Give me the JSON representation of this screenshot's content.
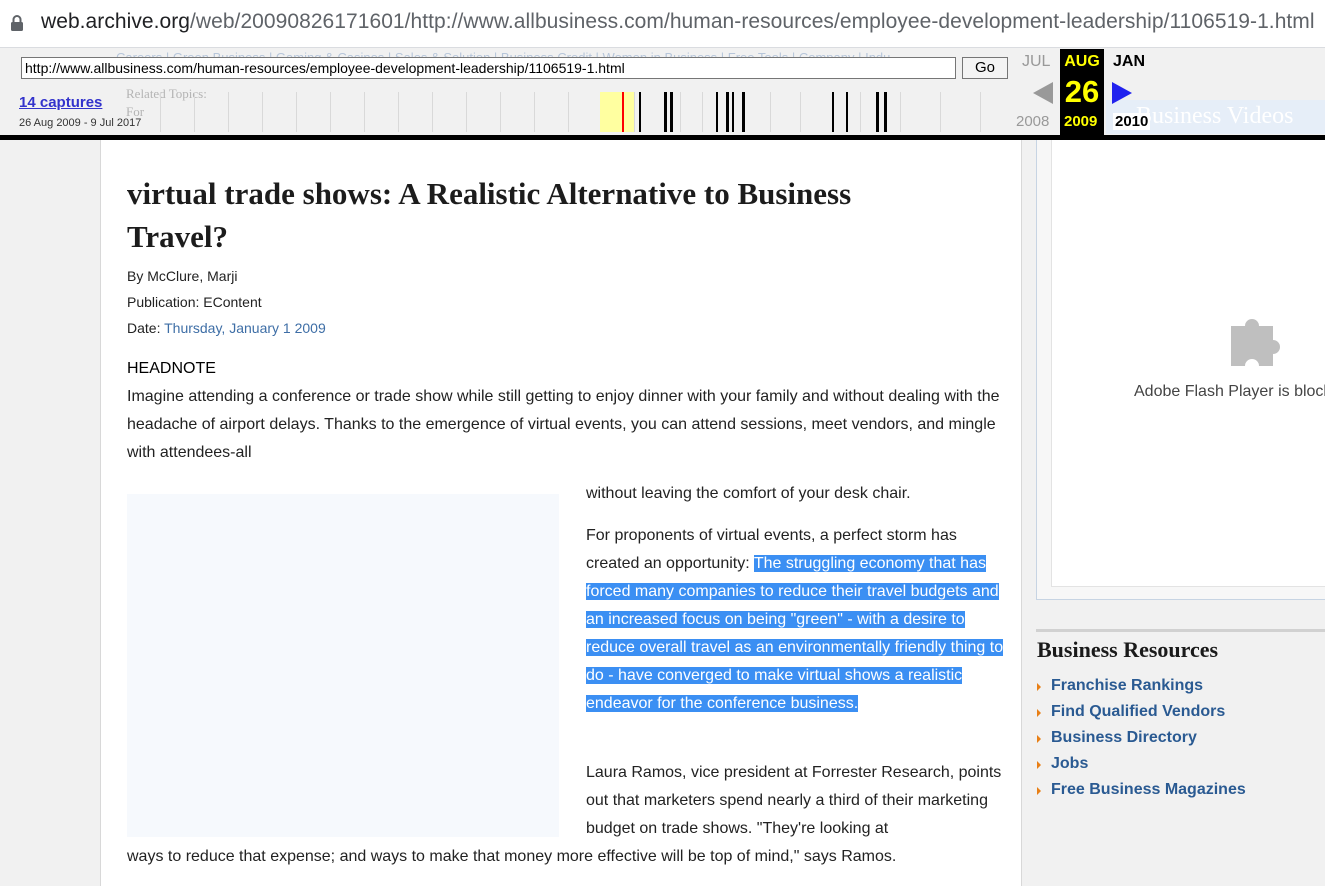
{
  "browser": {
    "url_host": "web.archive.org",
    "url_path": "/web/20090826171601/http://www.allbusiness.com/human-resources/employee-development-leadership/1106519-1.html"
  },
  "background": {
    "ghost_nav": "Careers  |  Green Business  |  Gaming & Casinos  |  Sales & Solution  |  Business Credit  |  Women in Business  |  Free Tools  |  Company  |  Indu",
    "ghost_related": "Related Topics:",
    "ghost_for": "For",
    "ghost_videos": "Business Videos"
  },
  "wayback": {
    "url_value": "http://www.allbusiness.com/human-resources/employee-development-leadership/1106519-1.html",
    "go_label": "Go",
    "captures_label": "14 captures",
    "range_label": "26 Aug 2009 - 9 Jul 2017",
    "prev_month": "JUL",
    "current_month": "AUG",
    "next_month": "JAN",
    "prev_year": "2008",
    "current_day": "26",
    "current_year": "2009",
    "next_year": "2010"
  },
  "article": {
    "headline": "virtual trade shows: A Realistic Alternative to Business Travel?",
    "byline": "By McClure, Marji",
    "publication": "Publication: EContent",
    "date_label": "Date: ",
    "date_value": "Thursday, January 1 2009",
    "headnote": "HEADNOTE",
    "intro": "Imagine attending a conference or trade show while still getting to enjoy dinner with your family and without dealing with the headache of airport delays. Thanks to the emergence of virtual events, you can attend sessions, meet vendors, and mingle with attendees-all",
    "p1": "without leaving the comfort of your desk chair.",
    "p2_lead": "For proponents of virtual events, a perfect storm has created an opportunity: ",
    "p2_selected": "The struggling economy that has forced many companies to reduce their travel budgets and an increased focus on being \"green\" - with a desire to reduce overall travel as an environmentally friendly thing to do - have converged to make virtual shows a realistic endeavor for the conference business.",
    "p3_right": "Laura Ramos, vice president at Forrester Research, points out that marketers spend nearly a third of their marketing budget on trade shows. \"They're looking at",
    "p3_full": "ways to reduce that expense; and ways to make that money more effective will be top of mind,\" says Ramos."
  },
  "sidebar": {
    "flash_message": "Adobe Flash Player is blocked",
    "resources_title": "Business Resources",
    "resources": [
      {
        "label": "Franchise Rankings"
      },
      {
        "label": "Find Qualified Vendors"
      },
      {
        "label": "Business Directory"
      },
      {
        "label": "Jobs"
      },
      {
        "label": "Free Business Magazines"
      }
    ]
  },
  "colors": {
    "selection": "#3b8ff3",
    "link_blue": "#2a5a92",
    "wayback_highlight": "#ffff00",
    "bullet_orange": "#e87f16"
  },
  "icons": [
    "lock-icon",
    "prev-capture-arrow-icon",
    "next-capture-arrow-icon",
    "plugin-puzzle-icon",
    "bullet-arrow-icon"
  ]
}
